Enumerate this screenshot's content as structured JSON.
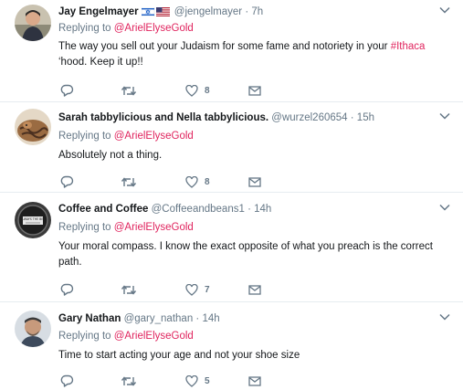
{
  "tweets": [
    {
      "name": "Jay Engelmayer",
      "handle": "@jengelmayer",
      "separator": "·",
      "time": "7h",
      "has_flags": true,
      "replying_prefix": "Replying to ",
      "replying_to": "@ArielElyseGold",
      "text_before": "The way you sell out your Judaism for some fame and notoriety in your ",
      "hashtag": "#Ithaca",
      "text_after": " ‘hood. Keep it up!!",
      "likes": "8"
    },
    {
      "name": "Sarah tabbylicious and Nella tabbylicious.",
      "handle": "@wurzel260654",
      "separator": "·",
      "time": "15h",
      "replying_prefix": "Replying to ",
      "replying_to": "@ArielElyseGold",
      "text": "Absolutely not a thing.",
      "likes": "8"
    },
    {
      "name": "Coffee and Coffee",
      "handle": "@Coffeeandbeans1",
      "separator": "·",
      "time": "14h",
      "replying_prefix": "Replying to ",
      "replying_to": "@ArielElyseGold",
      "text": "Your moral compass.  I know the exact opposite of what you preach is the correct path.",
      "avatar_text": "ALWAYS THE BED",
      "likes": "7"
    },
    {
      "name": "Gary Nathan",
      "handle": "@gary_nathan",
      "separator": "·",
      "time": "14h",
      "replying_prefix": "Replying to ",
      "replying_to": "@ArielElyseGold",
      "text": "Time to start acting your age and not your shoe size",
      "likes": "5"
    }
  ],
  "icons": {
    "reply": "reply-icon",
    "retweet": "retweet-icon",
    "like": "heart-icon",
    "message": "envelope-icon",
    "more": "chevron-down-icon"
  },
  "colors": {
    "mention": "#e0245e",
    "secondary": "#657786",
    "border": "#e6ecf0",
    "text": "#14171a"
  }
}
